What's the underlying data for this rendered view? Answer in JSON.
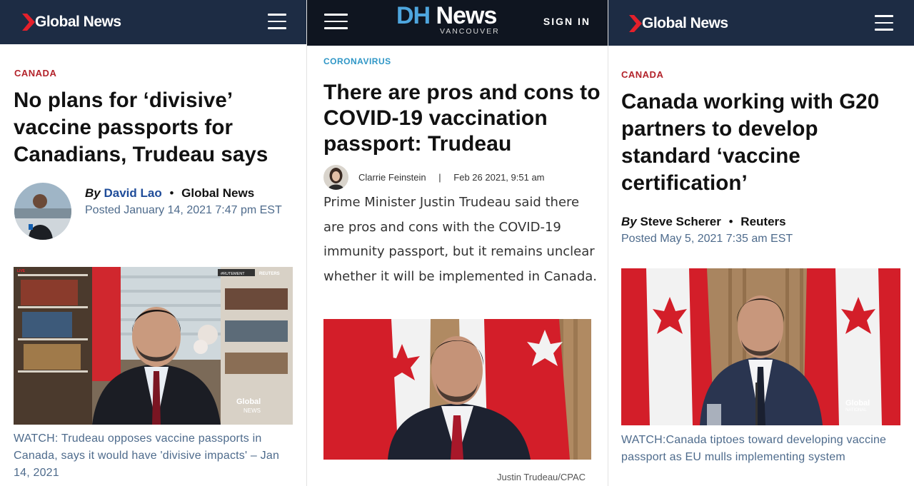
{
  "panel1": {
    "brand": "Global News",
    "kicker": "CANADA",
    "headline": "No plans for ‘divisive’ vaccine passports for Canadians, Trudeau says",
    "by": "By",
    "author": "David Lao",
    "sep": "•",
    "source": "Global News",
    "posted": "Posted January 14, 2021 7:47 pm EST",
    "photo_tag_left": "#RUTEMENT",
    "photo_tag_right": "REUTERS",
    "watermark_top": "Global",
    "watermark_bottom": "NEWS",
    "caption": "WATCH: Trudeau opposes vaccine passports in Canada, says it would have 'divisive impacts' – Jan 14, 2021"
  },
  "panel2": {
    "brand_d": "DH",
    "brand_rest": " News",
    "brand_sub": "VANCOUVER",
    "signin": "SIGN IN",
    "kicker": "CORONAVIRUS",
    "headline": "There are pros and cons to COVID-19 vaccination passport: Trudeau",
    "author": "Clarrie Feinstein",
    "meta_sep": "|",
    "date": "Feb 26 2021, 9:51 am",
    "body": "Prime Minister Justin Trudeau said there are pros and cons with the COVID-19 immunity passport, but it remains unclear whether it will be implemented in Canada.",
    "credit": "Justin Trudeau/CPAC"
  },
  "panel3": {
    "brand": "Global News",
    "kicker": "CANADA",
    "headline": "Canada working with G20 partners to develop standard ‘vaccine certification’",
    "by": "By",
    "author": "Steve Scherer",
    "sep": "•",
    "source": "Reuters",
    "posted": "Posted May 5, 2021 7:35 am EST",
    "watermark_top": "Global",
    "watermark_bottom": "NATIONAL",
    "caption": "WATCH:Canada tiptoes toward developing vaccine passport as EU mulls implementing system"
  },
  "colors": {
    "gn_navy": "#1d2c44",
    "gn_red": "#e4202b",
    "kicker_red": "#b3232b",
    "author_blue": "#1f4c99",
    "meta_slate": "#4e6b8c",
    "dh_blue": "#4ea6de",
    "dh_kicker": "#2e96c6"
  }
}
